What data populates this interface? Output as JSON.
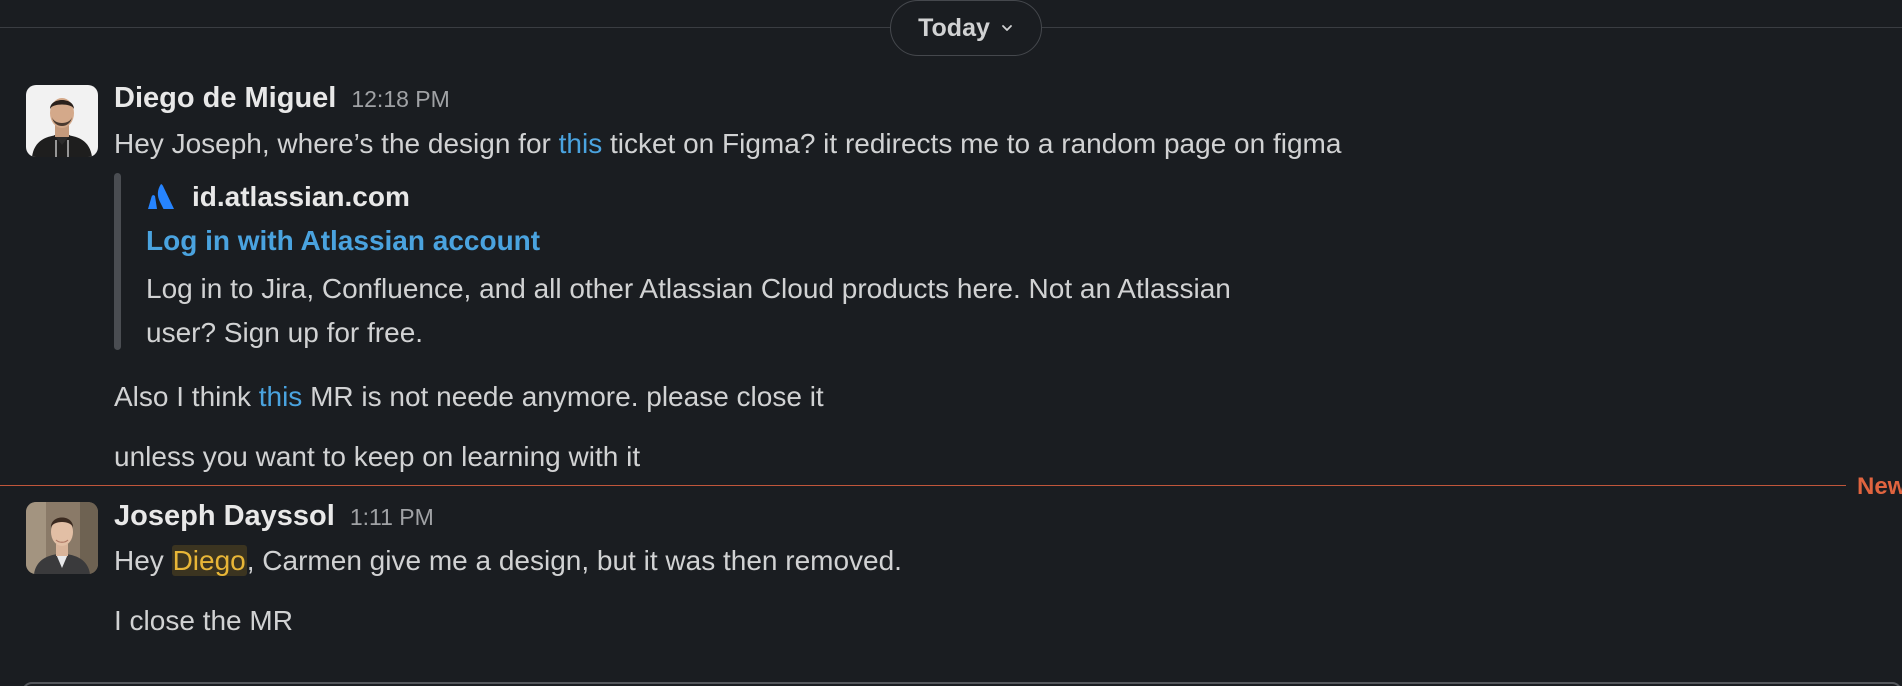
{
  "day_divider": {
    "label": "Today"
  },
  "messages": [
    {
      "sender": "Diego de Miguel",
      "time": "12:18 PM",
      "line1": {
        "before": "Hey Joseph, where’s the design for ",
        "link": "this",
        "after": " ticket on Figma? it redirects me to a random page on figma"
      },
      "unfurl": {
        "site": "id.atlassian.com",
        "title": "Log in with Atlassian account",
        "description": "Log in to Jira, Confluence, and all other Atlassian Cloud products here. Not an Atlassian user? Sign up for free."
      },
      "line2": {
        "before": "Also I think ",
        "link": "this",
        "after": " MR is not neede anymore. please close it"
      },
      "line3": "unless you want to keep on learning with it"
    },
    {
      "sender": "Joseph Dayssol",
      "time": "1:11 PM",
      "line1": {
        "before": "Hey ",
        "mention": "Diego",
        "after": ", Carmen give me a design, but it was then removed."
      },
      "line2": "I close the MR"
    }
  ],
  "new_divider": {
    "label": "New"
  },
  "colors": {
    "background": "#1a1d21",
    "link": "#4aa3df",
    "mention_text": "#e8b637",
    "new_divider": "#e0643f"
  }
}
